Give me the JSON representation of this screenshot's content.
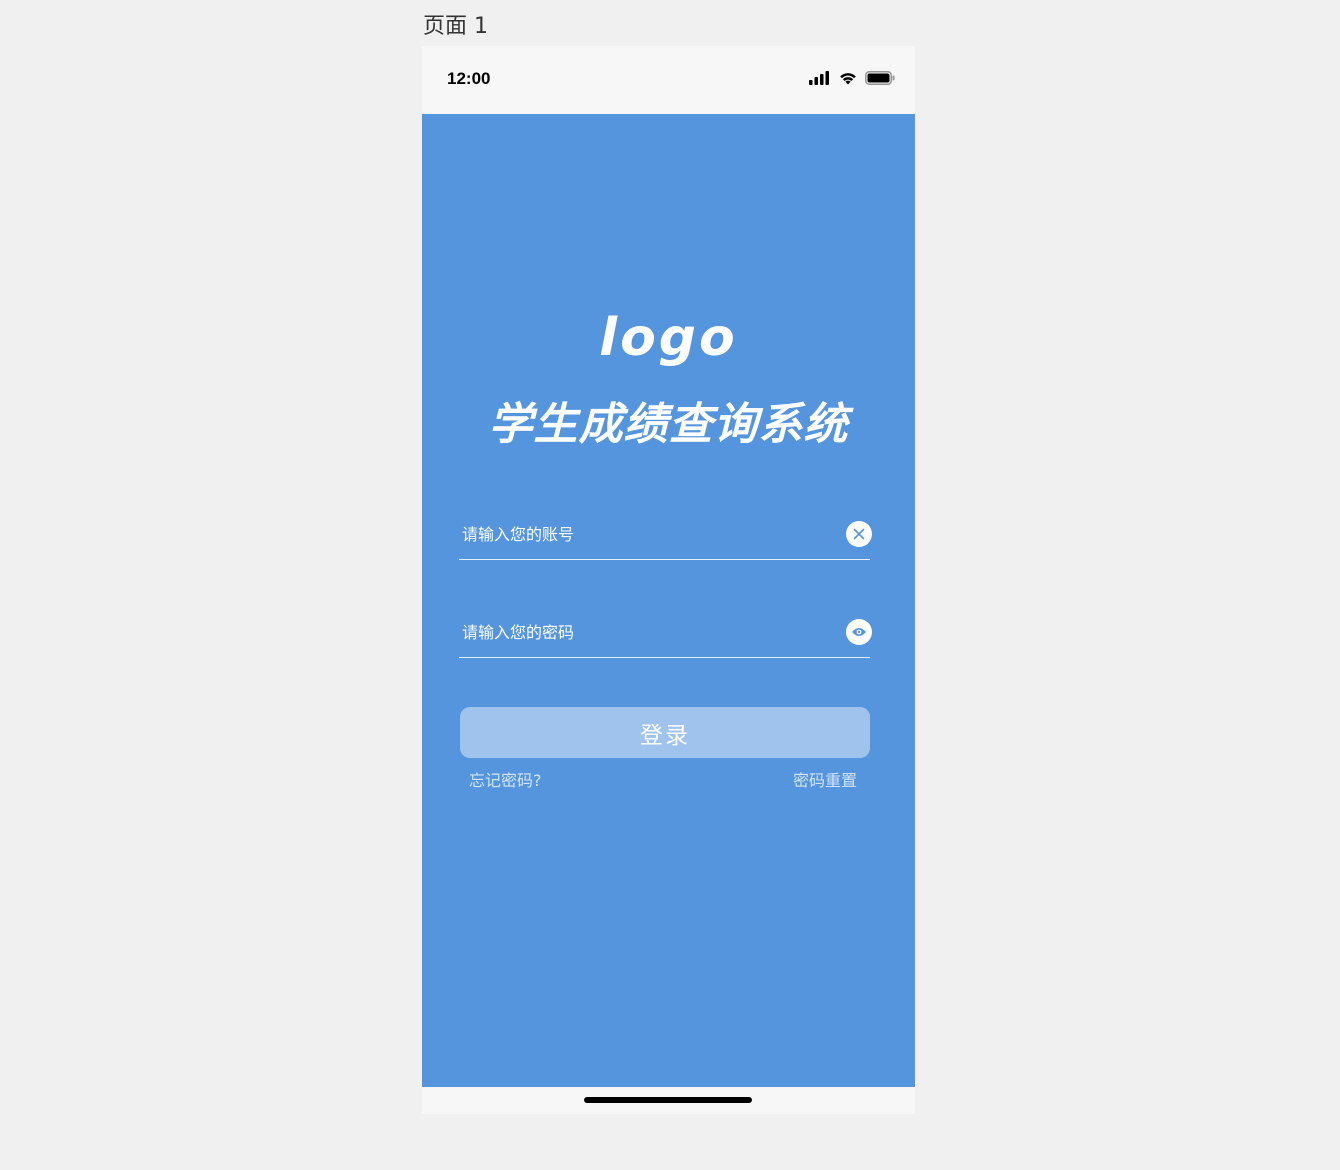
{
  "page": {
    "label": "页面 1"
  },
  "status_bar": {
    "time": "12:00",
    "icons": [
      "signal-icon",
      "wifi-icon",
      "battery-icon"
    ]
  },
  "brand": {
    "logo_text": "logo",
    "title": "学生成绩查询系统"
  },
  "form": {
    "account": {
      "value": "",
      "placeholder": "请输入您的账号",
      "action_icon": "clear-icon"
    },
    "password": {
      "value": "",
      "placeholder": "请输入您的密码",
      "action_icon": "eye-icon"
    },
    "login_label": "登录",
    "forgot_label": "忘记密码?",
    "reset_label": "密码重置"
  },
  "colors": {
    "background": "#5495de",
    "button": "#a0c3ee",
    "bars": "#f7f7f7",
    "canvas": "#f0f0f0"
  }
}
